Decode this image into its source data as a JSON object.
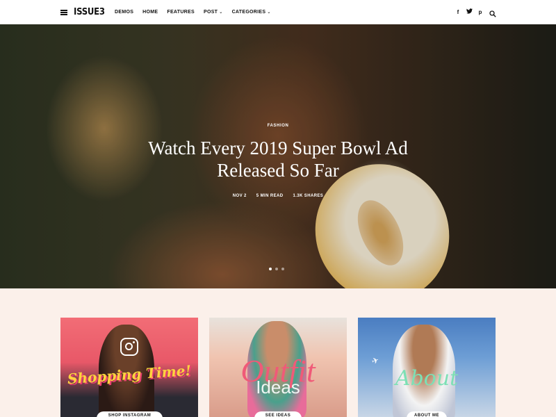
{
  "header": {
    "logo": "ISSUE3",
    "nav": [
      {
        "label": "DEMOS",
        "has_dropdown": false
      },
      {
        "label": "HOME",
        "has_dropdown": false
      },
      {
        "label": "FEATURES",
        "has_dropdown": false
      },
      {
        "label": "POST",
        "has_dropdown": true
      },
      {
        "label": "CATEGORIES",
        "has_dropdown": true
      }
    ],
    "social": [
      {
        "icon": "facebook-icon",
        "glyph": "f"
      },
      {
        "icon": "twitter-icon",
        "glyph": "t"
      },
      {
        "icon": "pinterest-icon",
        "glyph": "p"
      }
    ],
    "dropdown_glyph": "⌄"
  },
  "hero": {
    "category": "FASHION",
    "title": "Watch Every 2019 Super Bowl Ad Released So Far",
    "meta": [
      "NOV 2",
      "5 MIN READ",
      "1.3K SHARES"
    ],
    "slides_total": 3,
    "active_slide": 1
  },
  "cards": [
    {
      "title": "Shopping Time!",
      "button": "SHOP INSTAGRAM",
      "icon": "instagram-icon"
    },
    {
      "title": "Outfit",
      "subtitle": "Ideas",
      "button": "SEE IDEAS",
      "icon": ""
    },
    {
      "title": "About",
      "button": "ABOUT ME",
      "icon": "airplane-icon"
    }
  ],
  "colors": {
    "lower_bg": "#fbf0ea",
    "card1_title": "#ffd23f",
    "card2_title": "#f05a78",
    "card3_title": "#7de0b5"
  }
}
